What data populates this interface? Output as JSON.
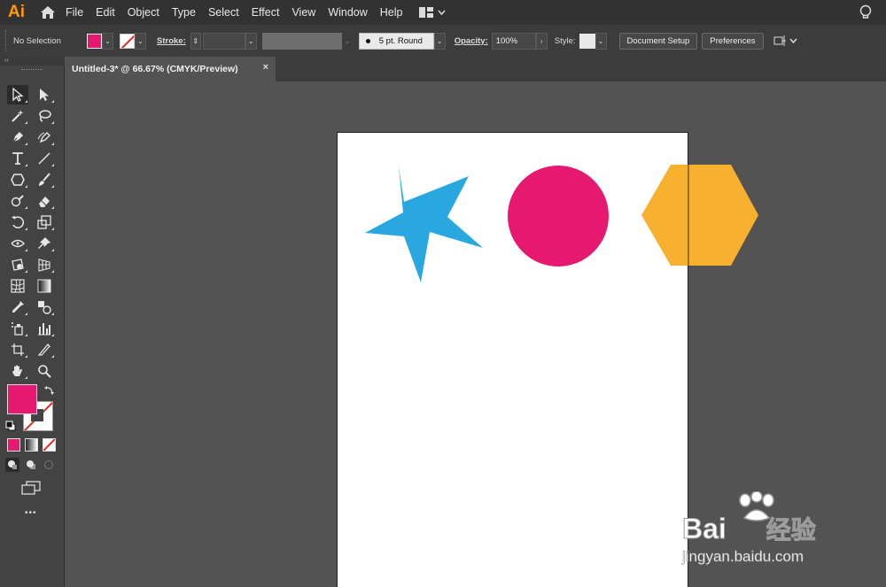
{
  "app": {
    "logo_text": "Ai"
  },
  "menu": {
    "items": [
      "File",
      "Edit",
      "Object",
      "Type",
      "Select",
      "Effect",
      "View",
      "Window",
      "Help"
    ]
  },
  "control_bar": {
    "selection_label": "No Selection",
    "stroke_label": "Stroke:",
    "stroke_value": "",
    "brush_value": "5 pt. Round",
    "opacity_label": "Opacity:",
    "opacity_value": "100%",
    "style_label": "Style:",
    "document_setup_label": "Document Setup",
    "preferences_label": "Preferences",
    "fill_color": "#e6186f"
  },
  "document": {
    "tab_title": "Untitled-3* @ 66.67% (CMYK/Preview)",
    "close_glyph": "×"
  },
  "colors": {
    "star": "#29a8e0",
    "circle": "#e6186f",
    "hexagon": "#f7b12f",
    "fill_swatch": "#e6186f"
  },
  "toolbar": {
    "collapse_glyph": "‹‹",
    "more_glyph": "•••"
  },
  "watermark": {
    "brand": "Bai",
    "brand_suffix": "经验",
    "url": "jingyan.baidu.com"
  }
}
